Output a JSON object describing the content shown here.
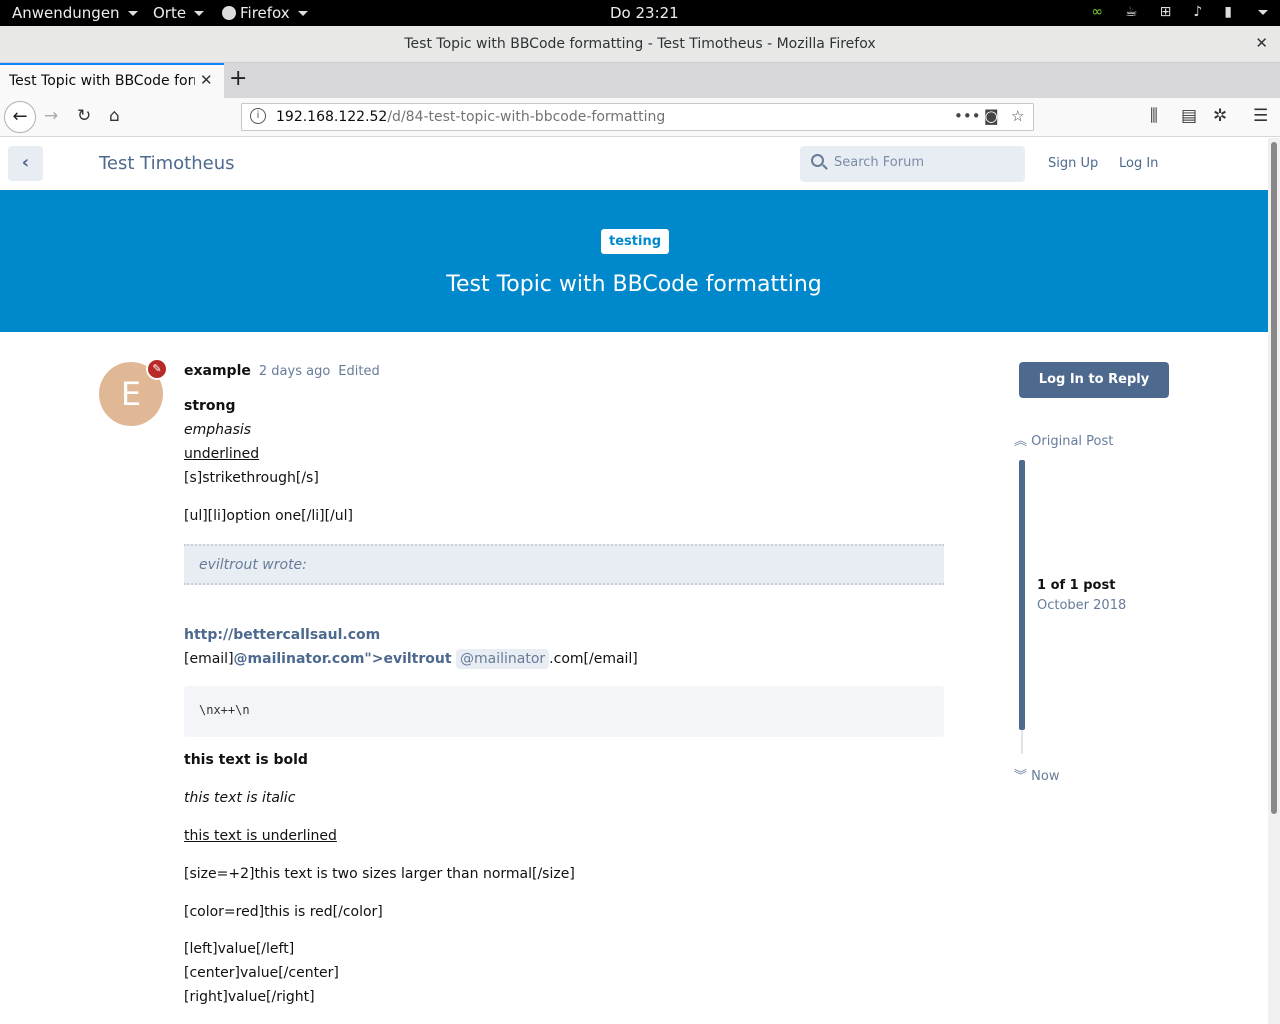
{
  "gnome": {
    "applications": "Anwendungen",
    "places": "Orte",
    "firefox": "Firefox",
    "clock": "Do 23:21"
  },
  "window": {
    "title": "Test Topic with BBCode formatting - Test Timotheus - Mozilla Firefox",
    "close": "✕"
  },
  "tab": {
    "title": "Test Topic with BBCode formatting",
    "close": "✕",
    "new": "+"
  },
  "urlbar": {
    "host": "192.168.122.52",
    "path": "/d/84-test-topic-with-bbcode-formatting"
  },
  "header": {
    "forum_title": "Test Timotheus",
    "search_placeholder": "Search Forum",
    "sign_up": "Sign Up",
    "log_in": "Log In"
  },
  "hero": {
    "tag": "testing",
    "title": "Test Topic with BBCode formatting"
  },
  "post": {
    "avatar_letter": "E",
    "username": "example",
    "time": "2 days ago",
    "edited": "Edited",
    "strong": "strong",
    "emphasis": "emphasis",
    "underlined": "underlined",
    "strikethrough": "[s]strikethrough[/s]",
    "list": "[ul][li]option one[/li][/ul]",
    "quote": "eviltrout wrote:",
    "link": "http://bettercallsaul.com",
    "email_prefix": "[email]",
    "email_link": "@mailinator.com\">eviltrout",
    "email_mention": "@mailinator",
    "email_suffix": ".com[/email]",
    "code": "\\nx++\\n",
    "bold_text": "this text is bold",
    "italic_text": "this text is italic",
    "underline_text": "this text is underlined",
    "size_text": "[size=+2]this text is two sizes larger than normal[/size]",
    "color_text": "[color=red]this is red[/color]",
    "left_text": "[left]value[/left]",
    "center_text": "[center]value[/center]",
    "right_text": "[right]value[/right]"
  },
  "sidebar": {
    "reply_button": "Log In to Reply",
    "original_post": "Original Post",
    "count": "1 of 1 post",
    "date": "October 2018",
    "now": "Now"
  },
  "colors": {
    "hero": "#0088cc",
    "primary": "#4d698e",
    "badge": "#b72a27",
    "avatar": "#e0b896"
  }
}
